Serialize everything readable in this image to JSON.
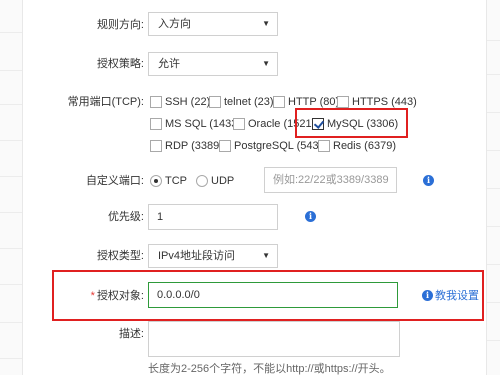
{
  "form": {
    "direction": {
      "label": "规则方向:",
      "value": "入方向"
    },
    "policy": {
      "label": "授权策略:",
      "value": "允许"
    },
    "ports": {
      "label": "常用端口(TCP):",
      "options": [
        {
          "label": "SSH (22)",
          "checked": false
        },
        {
          "label": "telnet (23)",
          "checked": false
        },
        {
          "label": "HTTP (80)",
          "checked": false
        },
        {
          "label": "HTTPS (443)",
          "checked": false
        },
        {
          "label": "MS SQL (1433)",
          "checked": false
        },
        {
          "label": "Oracle (1521)",
          "checked": false
        },
        {
          "label": "MySQL (3306)",
          "checked": true
        },
        {
          "label": "RDP (3389)",
          "checked": false
        },
        {
          "label": "PostgreSQL (5432)",
          "checked": false
        },
        {
          "label": "Redis (6379)",
          "checked": false
        }
      ]
    },
    "custom_port": {
      "label": "自定义端口:",
      "protocols": [
        "TCP",
        "UDP"
      ],
      "selected": "TCP",
      "placeholder": "例如:22/22或3389/3389"
    },
    "priority": {
      "label": "优先级:",
      "value": "1"
    },
    "auth_type": {
      "label": "授权类型:",
      "value": "IPv4地址段访问"
    },
    "auth_object": {
      "required_mark": "*",
      "label": "授权对象:",
      "value": "0.0.0.0/0",
      "help_link": "教我设置"
    },
    "description": {
      "label": "描述:",
      "hint": "长度为2-256个字符，不能以http://或https://开头。"
    }
  },
  "icons": {
    "info": "info-icon",
    "caret": "caret-down-icon",
    "check": "check-icon"
  },
  "colors": {
    "highlight": "#e02020",
    "accent": "#2b6fd6",
    "input_focus": "#2e9a3a"
  }
}
